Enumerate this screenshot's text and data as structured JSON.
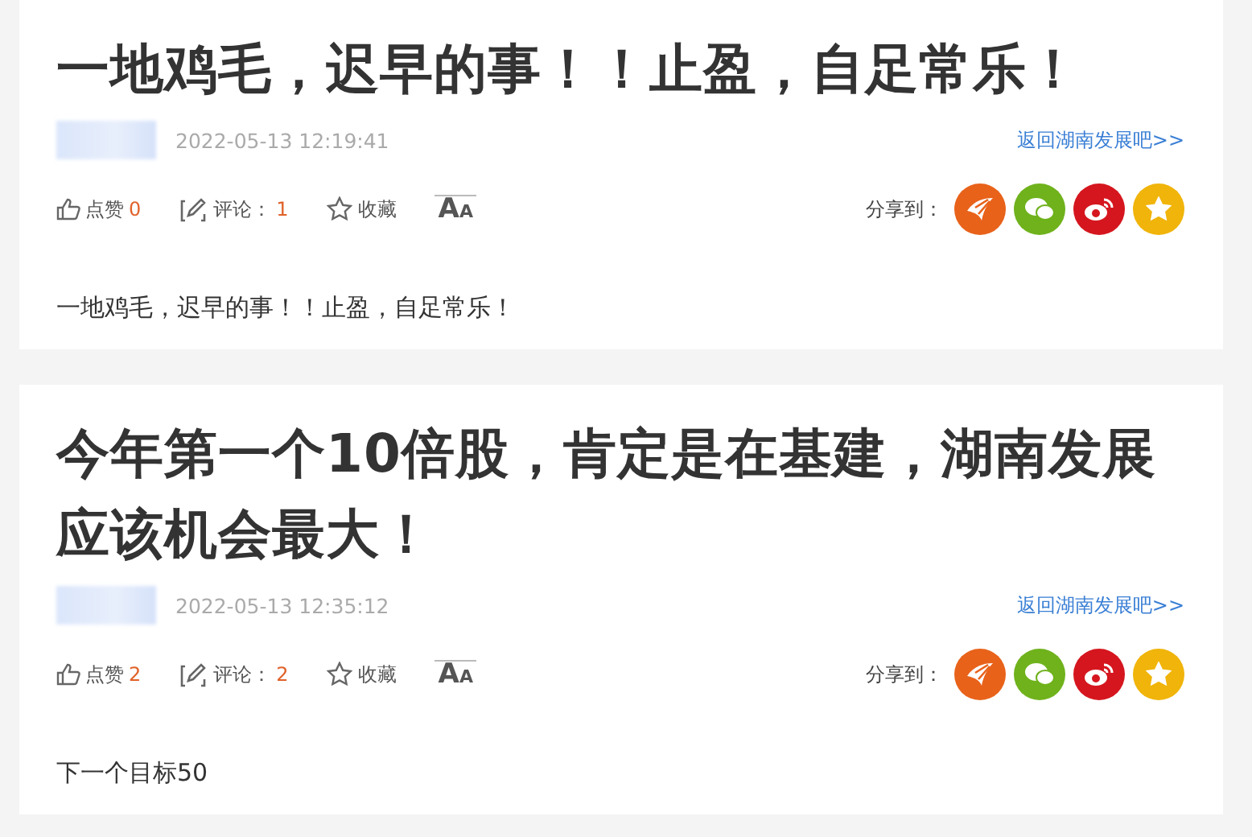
{
  "posts": [
    {
      "title": "一地鸡毛，迟早的事！！止盈，自足常乐！",
      "time": "2022-05-13 12:19:41",
      "back_link": "返回湖南发展吧>>",
      "like_label": "点赞",
      "like_count": "0",
      "comment_label": "评论：",
      "comment_count": "1",
      "favorite_label": "收藏",
      "font_size_label": "AA",
      "share_label": "分享到：",
      "body": "一地鸡毛，迟早的事！！止盈，自足常乐！"
    },
    {
      "title": "今年第一个10倍股，肯定是在基建，湖南发展应该机会最大！",
      "time": "2022-05-13 12:35:12",
      "back_link": "返回湖南发展吧>>",
      "like_label": "点赞",
      "like_count": "2",
      "comment_label": "评论：",
      "comment_count": "2",
      "favorite_label": "收藏",
      "font_size_label": "AA",
      "share_label": "分享到：",
      "body": "下一个目标50"
    }
  ]
}
